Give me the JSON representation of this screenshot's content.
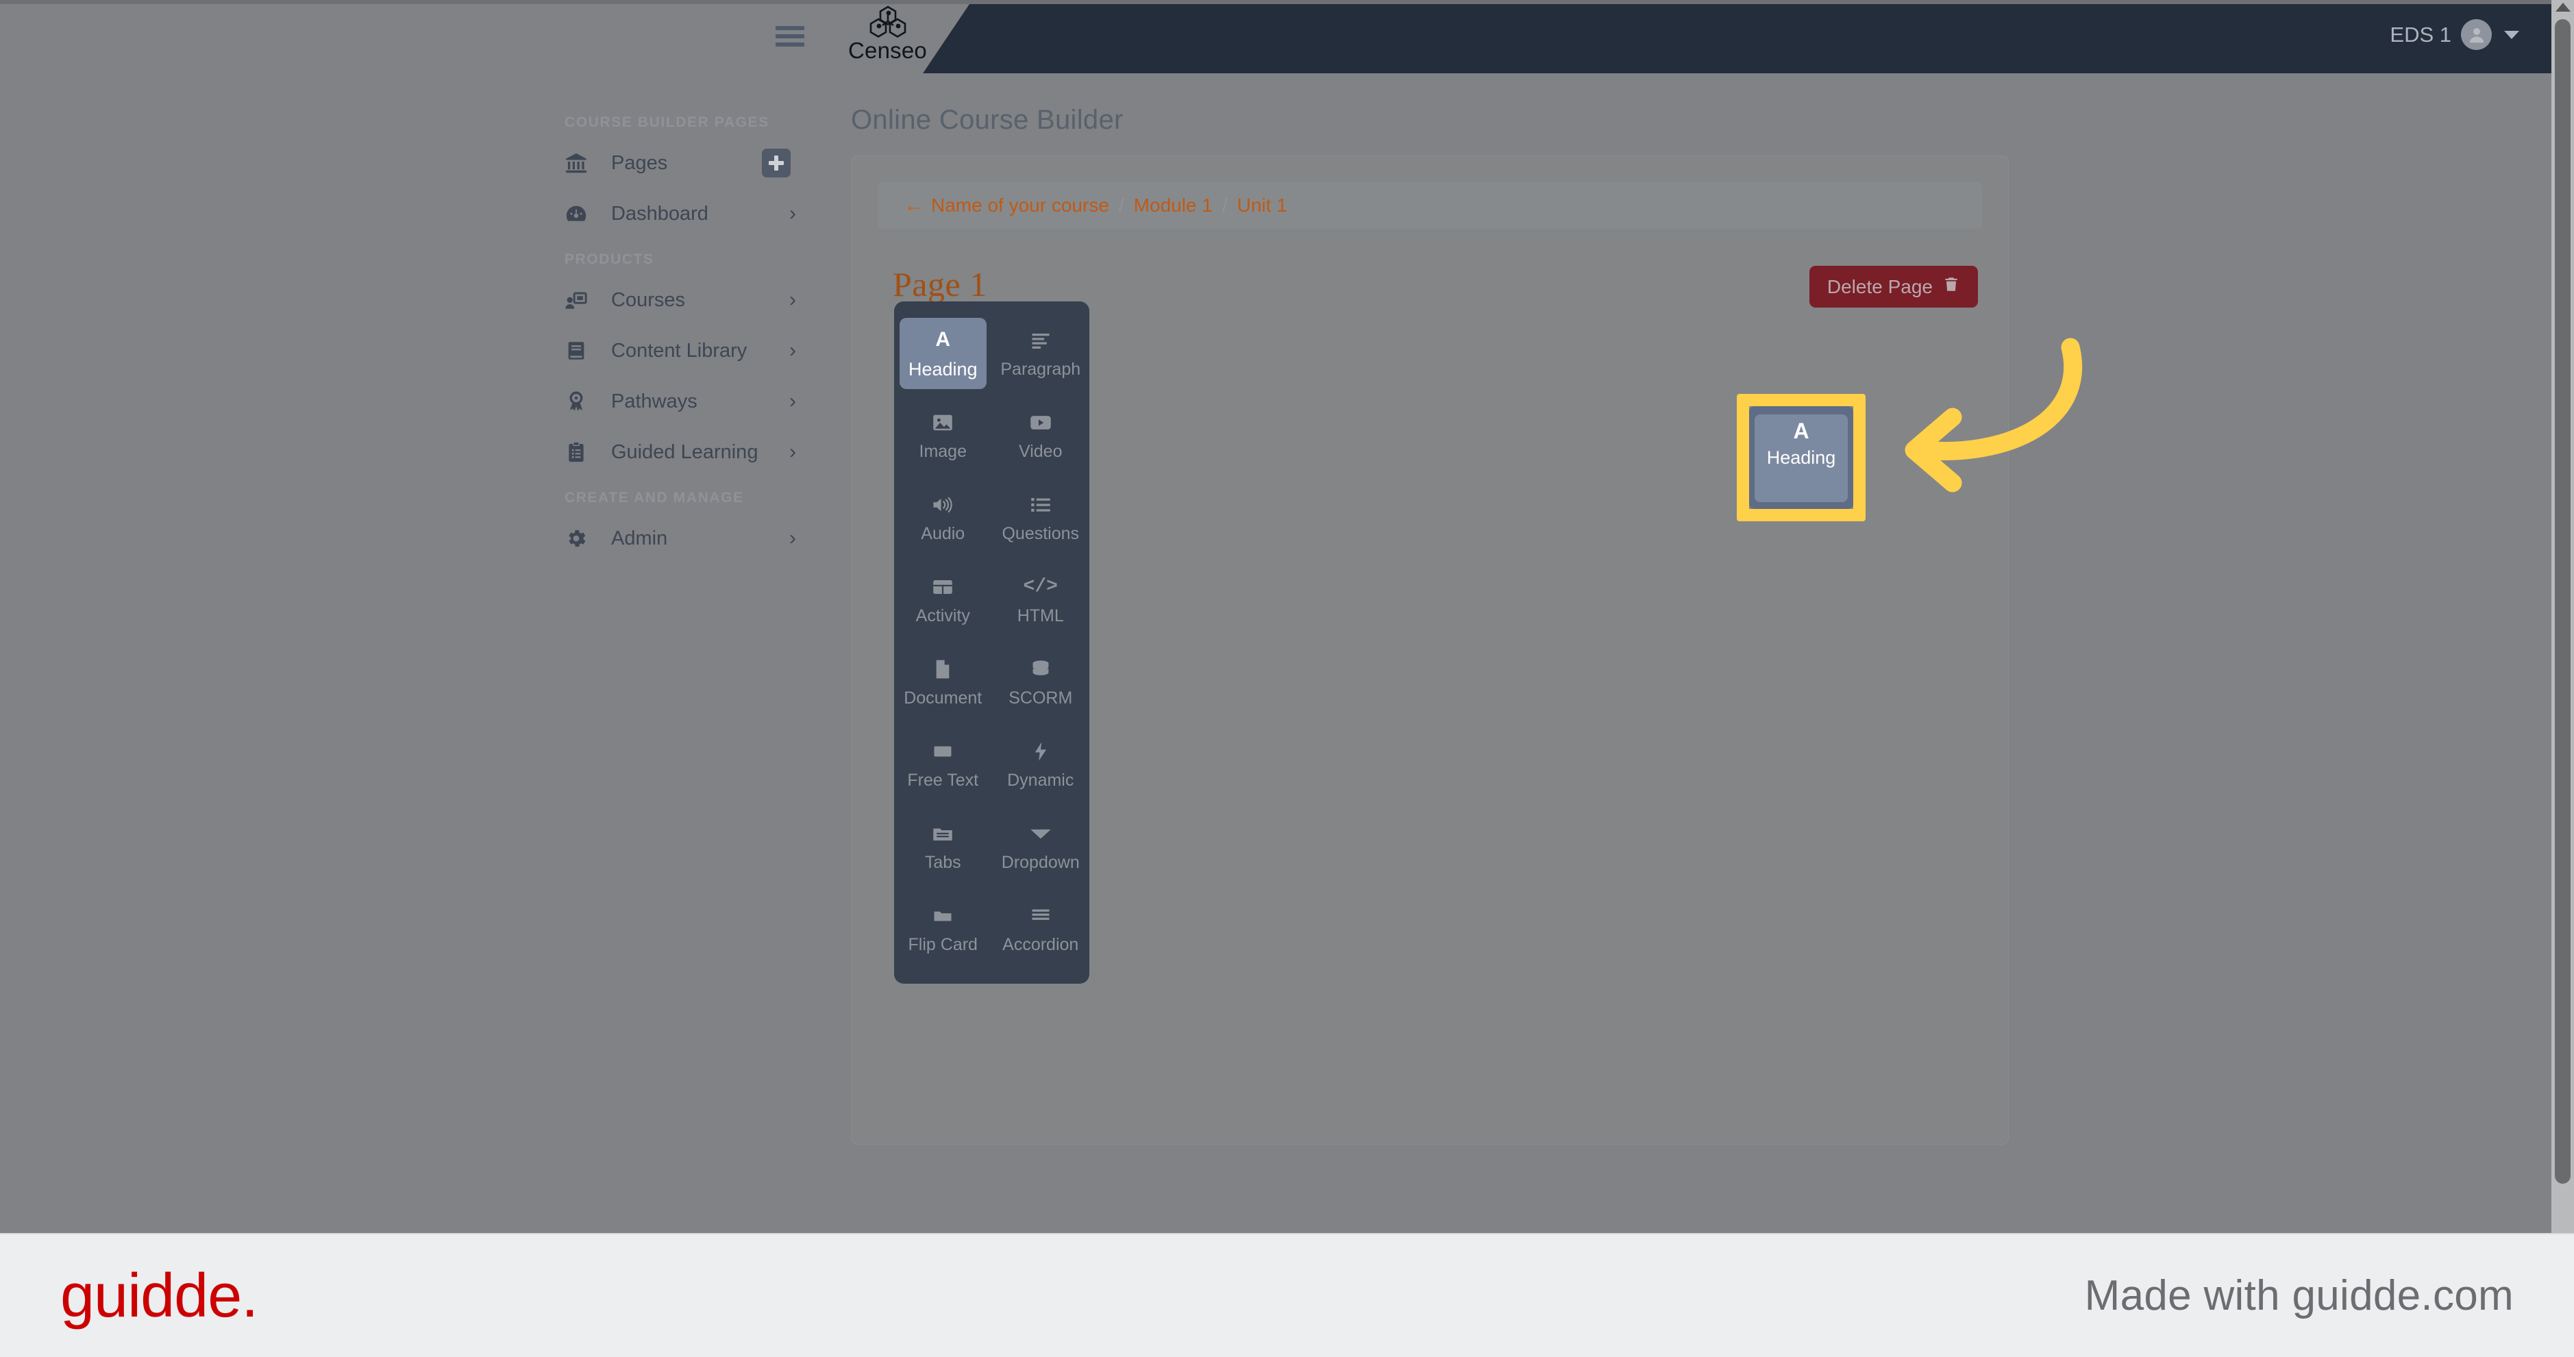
{
  "navbar": {
    "hamburger_icon": "hamburger-menu-icon",
    "brand_name": "Censeo",
    "brand_logo_icon": "censeo-hexagon-logo",
    "user_name": "EDS 1",
    "avatar_icon": "user-avatar-icon",
    "caret_icon": "chevron-down-icon"
  },
  "sidebar": {
    "sections": [
      {
        "title": "COURSE BUILDER PAGES",
        "items": [
          {
            "label": "Pages",
            "icon": "bank-columns-icon",
            "action": "add-icon",
            "chevron": false
          },
          {
            "label": "Dashboard",
            "icon": "gauge-icon",
            "chevron": true
          }
        ]
      },
      {
        "title": "PRODUCTS",
        "items": [
          {
            "label": "Courses",
            "icon": "presentation-person-icon",
            "chevron": true
          },
          {
            "label": "Content Library",
            "icon": "book-icon",
            "chevron": true
          },
          {
            "label": "Pathways",
            "icon": "award-ribbon-icon",
            "chevron": true
          },
          {
            "label": "Guided Learning",
            "icon": "clipboard-list-icon",
            "chevron": true
          }
        ]
      },
      {
        "title": "CREATE AND MANAGE",
        "items": [
          {
            "label": "Admin",
            "icon": "gear-icon",
            "chevron": true
          }
        ]
      }
    ]
  },
  "main": {
    "page_title": "Online Course Builder",
    "breadcrumb": {
      "back_icon": "arrow-left-icon",
      "items": [
        "Name of your course",
        "Module 1",
        "Unit 1"
      ],
      "separator": "/"
    },
    "page_label": "Page 1",
    "delete_button": {
      "label": "Delete Page",
      "icon": "trash-icon"
    }
  },
  "palette": {
    "tools": [
      {
        "label": "Heading",
        "icon": "letter-a-icon",
        "selected": true
      },
      {
        "label": "Paragraph",
        "icon": "paragraph-lines-icon",
        "selected": false
      },
      {
        "label": "Image",
        "icon": "image-icon",
        "selected": false
      },
      {
        "label": "Video",
        "icon": "video-play-icon",
        "selected": false
      },
      {
        "label": "Audio",
        "icon": "speaker-icon",
        "selected": false
      },
      {
        "label": "Questions",
        "icon": "list-ul-icon",
        "selected": false
      },
      {
        "label": "Activity",
        "icon": "table-icon",
        "selected": false
      },
      {
        "label": "HTML",
        "icon": "code-brackets-icon",
        "selected": false
      },
      {
        "label": "Document",
        "icon": "file-icon",
        "selected": false
      },
      {
        "label": "SCORM",
        "icon": "database-icon",
        "selected": false
      },
      {
        "label": "Free Text",
        "icon": "rectangle-icon",
        "selected": false
      },
      {
        "label": "Dynamic",
        "icon": "lightning-bolt-icon",
        "selected": false
      },
      {
        "label": "Tabs",
        "icon": "tabs-folder-icon",
        "selected": false
      },
      {
        "label": "Dropdown",
        "icon": "triangle-down-icon",
        "selected": false
      },
      {
        "label": "Flip Card",
        "icon": "folder-icon",
        "selected": false
      },
      {
        "label": "Accordion",
        "icon": "bars-icon",
        "selected": false
      }
    ]
  },
  "annotation": {
    "arrow_icon": "curved-arrow-pointing-left",
    "highlight_color": "#ffd04a"
  },
  "footer": {
    "logo_text": "guidde.",
    "tagline": "Made with guidde.com"
  },
  "colors": {
    "accent_orange": "#c05a16",
    "panel_dark": "#36404e",
    "navbar_dark": "#242d3c",
    "danger": "#7a1e28",
    "highlight_yellow": "#ffd04a",
    "brand_red": "#cc0000"
  }
}
